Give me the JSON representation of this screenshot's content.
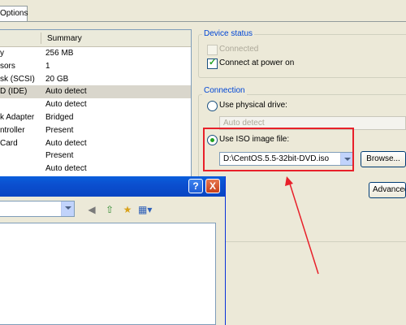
{
  "tab": {
    "label": "Options"
  },
  "device_list": {
    "columns": [
      "",
      "Summary"
    ],
    "rows": [
      {
        "name": "y",
        "summary": "256 MB",
        "selected": false
      },
      {
        "name": "sors",
        "summary": "1",
        "selected": false
      },
      {
        "name": "sk (SCSI)",
        "summary": "20 GB",
        "selected": false
      },
      {
        "name": "D (IDE)",
        "summary": "Auto detect",
        "selected": true
      },
      {
        "name": "",
        "summary": "Auto detect",
        "selected": false
      },
      {
        "name": "k Adapter",
        "summary": "Bridged",
        "selected": false
      },
      {
        "name": "ntroller",
        "summary": "Present",
        "selected": false
      },
      {
        "name": "Card",
        "summary": "Auto detect",
        "selected": false
      },
      {
        "name": "",
        "summary": "Present",
        "selected": false
      },
      {
        "name": "",
        "summary": "Auto detect",
        "selected": false
      }
    ]
  },
  "device_status": {
    "title": "Device status",
    "connected_label": "Connected",
    "connected_checked": false,
    "connected_enabled": false,
    "connect_power_label": "Connect at power on",
    "connect_power_checked": true
  },
  "connection": {
    "title": "Connection",
    "physical_label": "Use physical drive:",
    "physical_value": "Auto detect",
    "iso_label": "Use ISO image file:",
    "iso_value": "D:\\CentOS.5.5-32bit-DVD.iso",
    "browse_label": "Browse...",
    "advanced_label": "Advanced..."
  },
  "dialog": {
    "help_glyph": "?",
    "close_glyph": "X"
  },
  "colors": {
    "annotation": "#e8202a",
    "titlebar": "#0b4fcf"
  },
  "icons": [
    "back-icon",
    "up-folder-icon",
    "new-folder-icon",
    "view-menu-icon",
    "help-icon",
    "close-icon"
  ]
}
